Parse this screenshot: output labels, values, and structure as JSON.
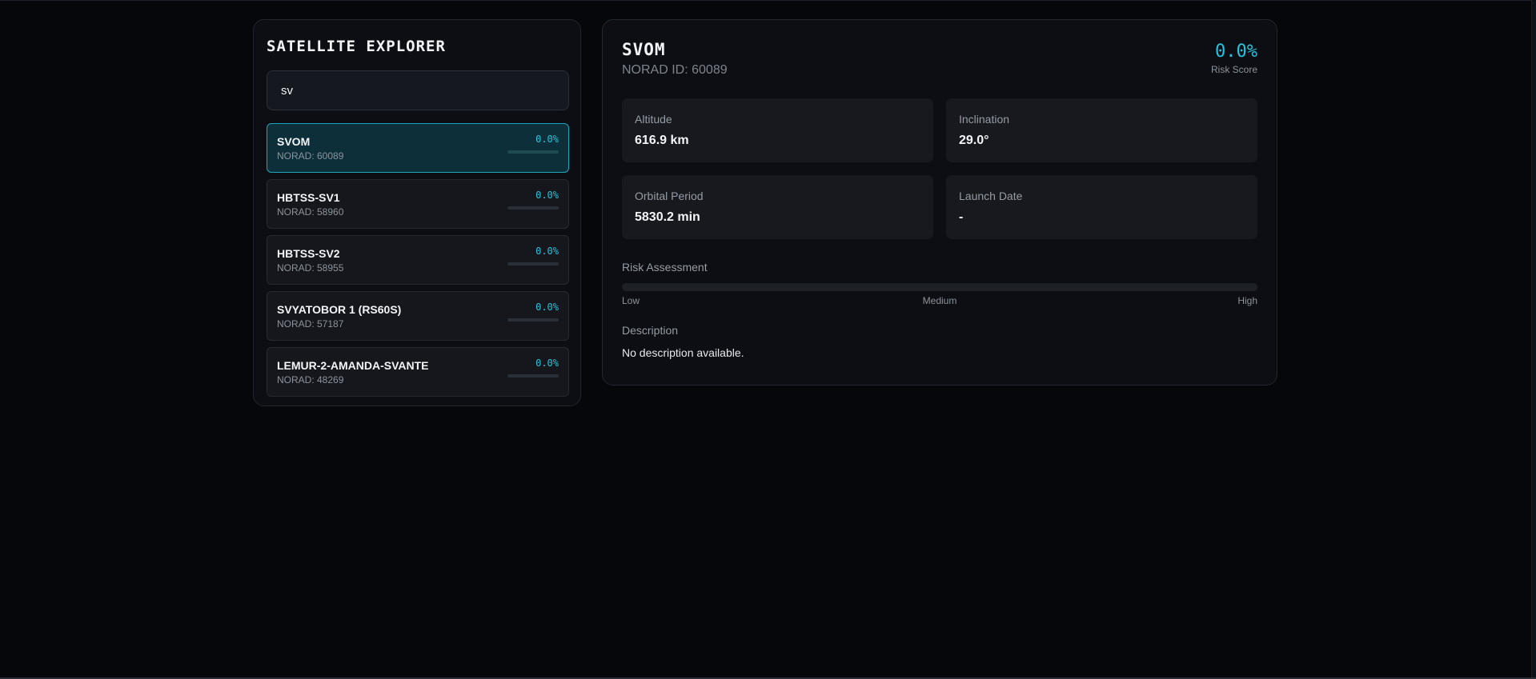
{
  "explorer": {
    "title": "SATELLITE EXPLORER",
    "search_value": "sv",
    "search_placeholder": "",
    "items": [
      {
        "name": "SVOM",
        "norad": "NORAD: 60089",
        "risk": "0.0%",
        "risk_fraction": 0,
        "selected": true
      },
      {
        "name": "HBTSS-SV1",
        "norad": "NORAD: 58960",
        "risk": "0.0%",
        "risk_fraction": 0,
        "selected": false
      },
      {
        "name": "HBTSS-SV2",
        "norad": "NORAD: 58955",
        "risk": "0.0%",
        "risk_fraction": 0,
        "selected": false
      },
      {
        "name": "SVYATOBOR 1 (RS60S)",
        "norad": "NORAD: 57187",
        "risk": "0.0%",
        "risk_fraction": 0,
        "selected": false
      },
      {
        "name": "LEMUR-2-AMANDA-SVANTE",
        "norad": "NORAD: 48269",
        "risk": "0.0%",
        "risk_fraction": 0,
        "selected": false
      }
    ]
  },
  "details": {
    "name": "SVOM",
    "norad": "NORAD ID: 60089",
    "risk_score_value": "0.0%",
    "risk_score_label": "Risk Score",
    "stats": [
      {
        "label": "Altitude",
        "value": "616.9 km"
      },
      {
        "label": "Inclination",
        "value": "29.0°"
      },
      {
        "label": "Orbital Period",
        "value": "5830.2 min"
      },
      {
        "label": "Launch Date",
        "value": "-"
      }
    ],
    "risk_assessment": {
      "title": "Risk Assessment",
      "fraction": 0,
      "low": "Low",
      "medium": "Medium",
      "high": "High"
    },
    "description": {
      "title": "Description",
      "text": "No description available."
    }
  },
  "colors": {
    "accent": "#25c3dd",
    "background": "#05070b",
    "panel": "#0c0e13",
    "selected_bg": "#0d2f39"
  }
}
